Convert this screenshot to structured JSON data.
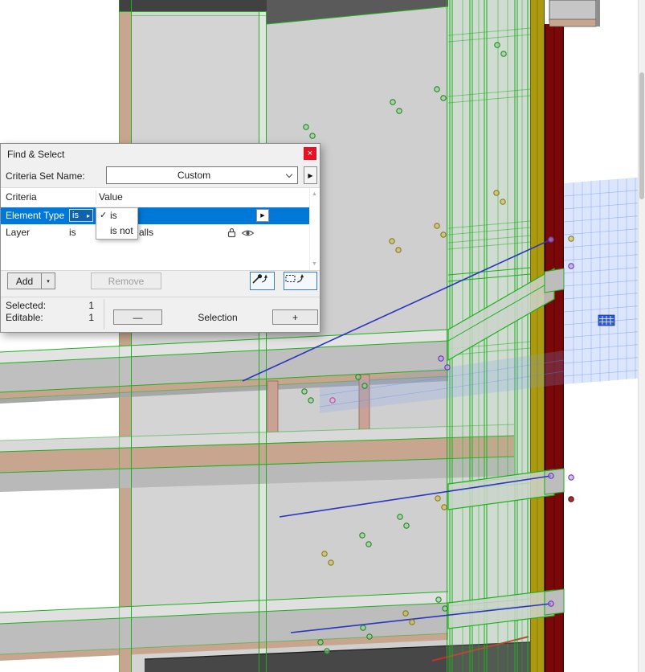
{
  "colors": {
    "selection_blue": "#0078d7",
    "close_red": "#e81123",
    "highlight_green": "#1db01d",
    "line_blue": "#2a35c0",
    "band_red": "#7a0808",
    "band_yellow": "#ab9a10",
    "column_tan": "#c8a58f",
    "grid_fill": "rgba(125,160,240,0.28)",
    "grid_line": "rgba(95,135,235,0.45)"
  },
  "icons": {
    "close": "×",
    "arrow_right": "▶",
    "dropdown_arrow": "▾",
    "scroll_up": "▲",
    "scroll_down": "▼",
    "check": "✓",
    "operator_arrow": "▸",
    "minus": "—",
    "plus": "+"
  },
  "dialog": {
    "title": "Find & Select",
    "criteria_set": {
      "label": "Criteria Set Name:",
      "value": "Custom"
    },
    "table": {
      "headers": {
        "criteria": "Criteria",
        "value": "Value"
      },
      "rows": [
        {
          "criteria": "Element Type",
          "operator": "is"
        },
        {
          "criteria": "Layer",
          "operator": "is",
          "value_visible": "alls"
        }
      ]
    },
    "menu": {
      "items": [
        {
          "label": "is",
          "checked": true
        },
        {
          "label": "is not",
          "checked": false
        }
      ]
    },
    "buttons": {
      "add": "Add",
      "remove": "Remove"
    },
    "stats": {
      "selected_label": "Selected:",
      "selected_value": "1",
      "editable_label": "Editable:",
      "editable_value": "1",
      "selection_label": "Selection"
    }
  }
}
